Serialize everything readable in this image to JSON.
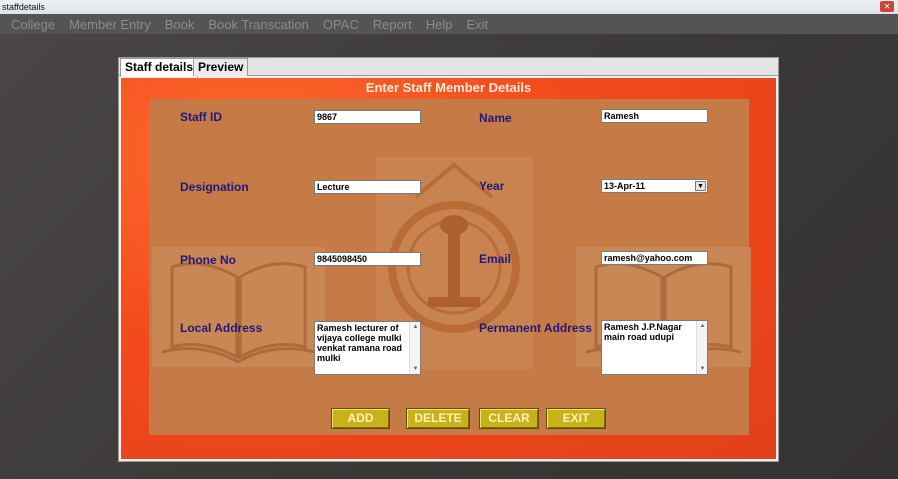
{
  "window": {
    "title": "staffdetails",
    "close_glyph": "✕"
  },
  "menu": [
    "College",
    "Member Entry",
    "Book",
    "Book Transcation",
    "OPAC",
    "Report",
    "Help",
    "Exit"
  ],
  "tabs": {
    "staff": "Staff details",
    "preview": "Preview"
  },
  "form": {
    "title": "Enter Staff Member Details",
    "labels": {
      "staff_id": "Staff ID",
      "name": "Name",
      "designation": "Designation",
      "year": "Year",
      "phone": "Phone No",
      "email": "Email",
      "local_address": "Local Address",
      "permanent_address": "Permanent Address"
    },
    "values": {
      "staff_id": "9867",
      "name": "Ramesh",
      "designation": "Lecture",
      "year": "13-Apr-11",
      "phone": "9845098450",
      "email": "ramesh@yahoo.com",
      "local_address": "Ramesh lecturer of vijaya college mulki venkat ramana road mulki",
      "permanent_address": "Ramesh J.P.Nagar main road udupi"
    }
  },
  "buttons": {
    "add": "ADD",
    "delete": "DELETE",
    "clear": "CLEAR",
    "exit": "EXIT"
  },
  "icons": {
    "dropdown": "chevron-down-icon",
    "scroll_up": "scroll-up-arrow-icon",
    "scroll_down": "scroll-down-arrow-icon"
  },
  "colors": {
    "panel": "#f24a1c",
    "form_bg": "#c67a46",
    "label": "#1f1a7a",
    "button": "#c8b218"
  }
}
